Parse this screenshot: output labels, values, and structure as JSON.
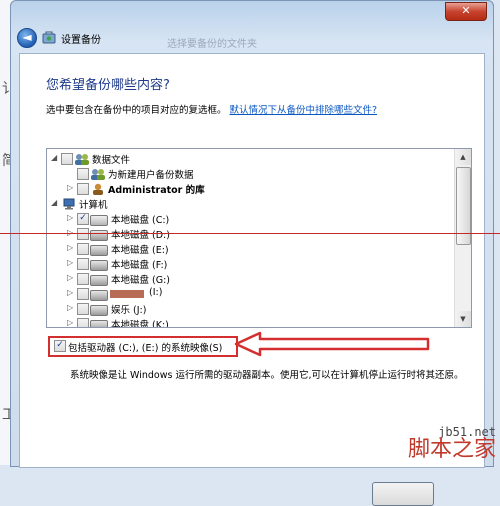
{
  "window": {
    "title": "设置备份",
    "close_label": "✕",
    "faded_text": "选择要备份的文件夹"
  },
  "page": {
    "heading": "您希望备份哪些内容?",
    "instruction": "选中要包含在备份中的项目对应的复选框。",
    "link": "默认情况下从备份中排除哪些文件?"
  },
  "tree": {
    "data_files": "数据文件",
    "new_users": "为新建用户备份数据",
    "library": "Administrator 的库",
    "computer": "计算机",
    "drives": [
      {
        "label": "本地磁盘 (C:)",
        "checked": true
      },
      {
        "label": "本地磁盘 (D:)",
        "checked": false
      },
      {
        "label": "本地磁盘 (E:)",
        "checked": false
      },
      {
        "label": "本地磁盘 (F:)",
        "checked": false
      },
      {
        "label": "本地磁盘 (G:)",
        "checked": false
      },
      {
        "label": "(I:)",
        "checked": false
      },
      {
        "label": "娱乐 (J:)",
        "checked": false
      },
      {
        "label": "本地磁盘 (K:)",
        "checked": false
      }
    ]
  },
  "include_system_image": {
    "label": "包括驱动器 (C:), (E:) 的系统映像(S)",
    "checked": true
  },
  "note": "系统映像是让 Windows 运行所需的驱动器副本。使用它,可以在计算机停止运行时将其还原。",
  "watermark": {
    "url": "jb51.net",
    "name": "脚本之家"
  },
  "colors": {
    "heading": "#1e3a8a",
    "link": "#0b57c2",
    "annotation": "#d32f2f"
  }
}
